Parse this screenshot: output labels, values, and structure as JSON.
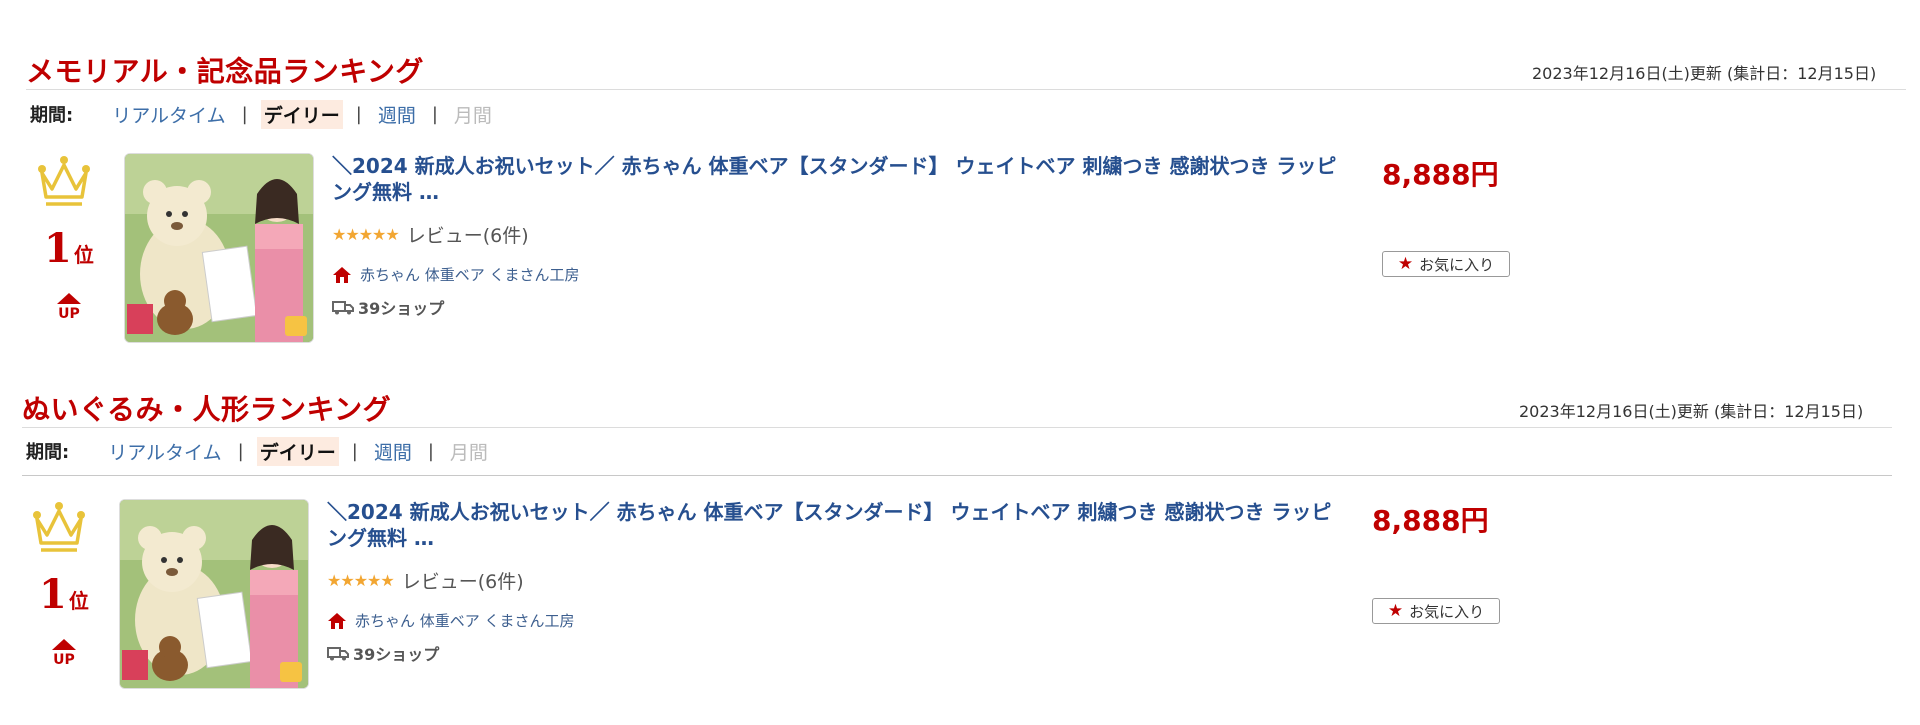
{
  "sections": [
    {
      "title": "メモリアル・記念品ランキング",
      "updated": "2023年12月16日(土)更新 (集計日：12月15日)",
      "period_label": "期間:",
      "periods": [
        "リアルタイム",
        "デイリー",
        "週間",
        "月間"
      ],
      "separator": "|",
      "item": {
        "rank_number": "1",
        "rank_unit": "位",
        "rank_change": "UP",
        "title": "＼2024 新成人お祝いセット／ 赤ちゃん 体重ベア【スタンダード】 ウェイトベア 刺繍つき 感謝状つき ラッピング無料 …",
        "rating": 4.5,
        "review_text": "レビュー(6件)",
        "shop_name": "赤ちゃん 体重ベア くまさん工房",
        "ship_text": "39ショップ",
        "price": "8,888円",
        "favorite_label": "お気に入り"
      }
    },
    {
      "title": "ぬいぐるみ・人形ランキング",
      "updated": "2023年12月16日(土)更新 (集計日：12月15日)",
      "period_label": "期間:",
      "periods": [
        "リアルタイム",
        "デイリー",
        "週間",
        "月間"
      ],
      "separator": "|",
      "item": {
        "rank_number": "1",
        "rank_unit": "位",
        "rank_change": "UP",
        "title": "＼2024 新成人お祝いセット／ 赤ちゃん 体重ベア【スタンダード】 ウェイトベア 刺繍つき 感謝状つき ラッピング無料 …",
        "rating": 4.5,
        "review_text": "レビュー(6件)",
        "shop_name": "赤ちゃん 体重ベア くまさん工房",
        "ship_text": "39ショップ",
        "price": "8,888円",
        "favorite_label": "お気に入り"
      }
    }
  ],
  "colors": {
    "accent_red": "#bf0000",
    "link_blue": "#264f8f",
    "crown_gold": "#e8c33a",
    "star_orange": "#f2a632"
  },
  "icons": {
    "crown": "crown-icon",
    "up": "up-arrow-icon",
    "shop": "shop-house-icon",
    "ship": "truck-icon",
    "favorite": "star-icon"
  }
}
